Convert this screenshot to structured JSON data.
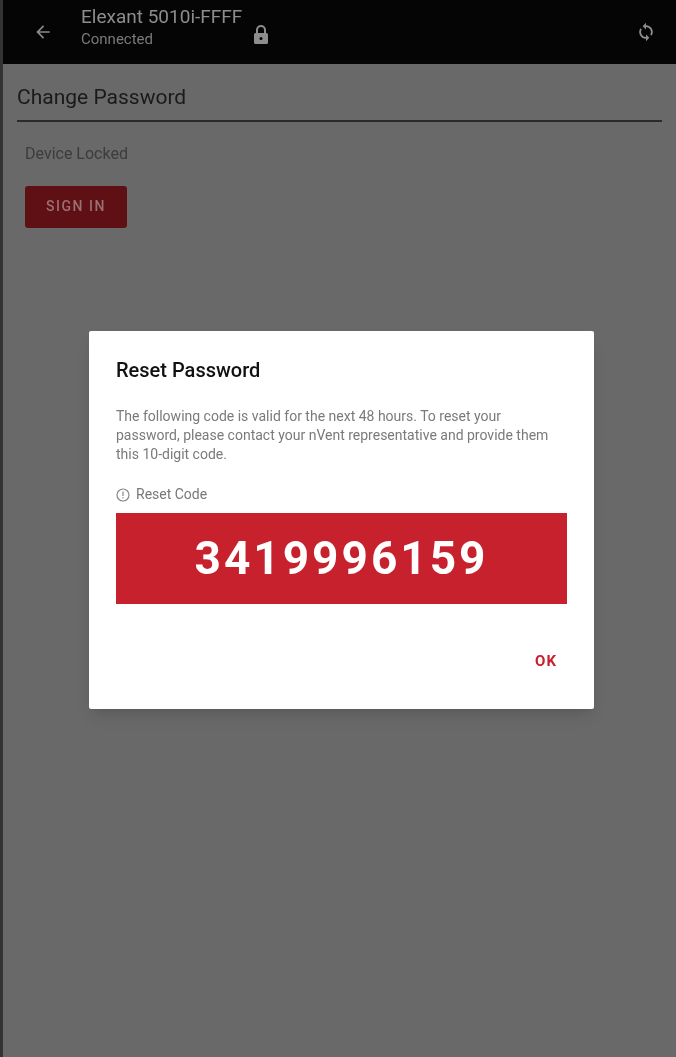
{
  "app_bar": {
    "title": "Elexant 5010i-FFFF",
    "subtitle": "Connected",
    "locked": true
  },
  "page": {
    "title": "Change Password",
    "status": "Device Locked",
    "sign_in_button": "SIGN IN"
  },
  "dialog": {
    "title": "Reset Password",
    "message": "The following code is valid for the next 48 hours. To reset your password, please contact your nVent representative and provide them this 10-digit code.",
    "code_label": "Reset Code",
    "code": "3419996159",
    "ok_button": "OK"
  }
}
